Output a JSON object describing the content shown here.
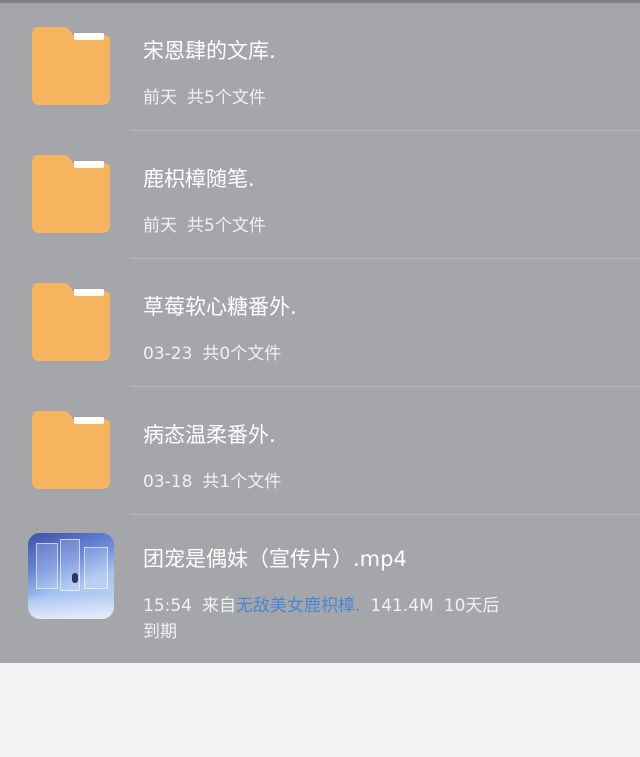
{
  "colors": {
    "list_background": "#a5a6aa",
    "folder": "#f6b45e",
    "link": "#4a86d2"
  },
  "items": [
    {
      "icon": "folder-icon",
      "name": "宋恩肆的文库.",
      "date": "前天",
      "count": "共5个文件"
    },
    {
      "icon": "folder-icon",
      "name": "鹿枳樟随笔.",
      "date": "前天",
      "count": "共5个文件"
    },
    {
      "icon": "folder-icon",
      "name": "草莓软心糖番外.",
      "date": "03-23",
      "count": "共0个文件"
    },
    {
      "icon": "folder-icon",
      "name": "病态温柔番外.",
      "date": "03-18",
      "count": "共1个文件"
    },
    {
      "icon": "video-thumbnail",
      "name": "团宠是偶妹（宣传片）.mp4",
      "time": "15:54",
      "source_prefix": "来自",
      "source_name": "无敌美女鹿枳樟.",
      "size": "141.4M",
      "expiry_line1": "10天后",
      "expiry_line2": "到期"
    }
  ]
}
